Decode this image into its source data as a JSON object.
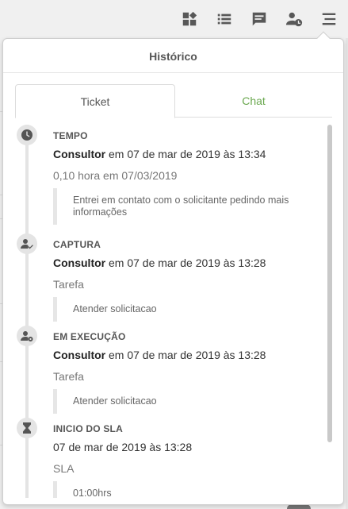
{
  "toolbar": {
    "icons": [
      "dashboard-icon",
      "list-icon",
      "chat-icon",
      "user-clock-icon",
      "menu-icon"
    ]
  },
  "panel": {
    "title": "Histórico",
    "tabs": [
      {
        "label": "Ticket",
        "active": true
      },
      {
        "label": "Chat",
        "active": false,
        "color": "#6aa84f"
      }
    ]
  },
  "timeline": {
    "entries": [
      {
        "icon": "clock-icon",
        "title": "TEMPO",
        "author": "Consultor",
        "date_text": "em 07 de mar de 2019 às 13:34",
        "sub": "0,10 hora em 07/03/2019",
        "note": "Entrei em contato com o solicitante pedindo mais informações"
      },
      {
        "icon": "user-check-icon",
        "title": "CAPTURA",
        "author": "Consultor",
        "date_text": "em 07 de mar de 2019 às 13:28",
        "sub": "Tarefa",
        "note": "Atender solicitacao"
      },
      {
        "icon": "user-gear-icon",
        "title": "EM EXECUÇÃO",
        "author": "Consultor",
        "date_text": "em 07 de mar de 2019 às 13:28",
        "sub": "Tarefa",
        "note": "Atender solicitacao"
      },
      {
        "icon": "hourglass-icon",
        "title": "INICIO DO SLA",
        "author": "",
        "date_text": "07 de mar de 2019 às 13:28",
        "sub": "SLA",
        "note": "01:00hrs"
      }
    ]
  },
  "colors": {
    "accent_chat": "#6aa84f",
    "icon_gray": "#585858"
  }
}
